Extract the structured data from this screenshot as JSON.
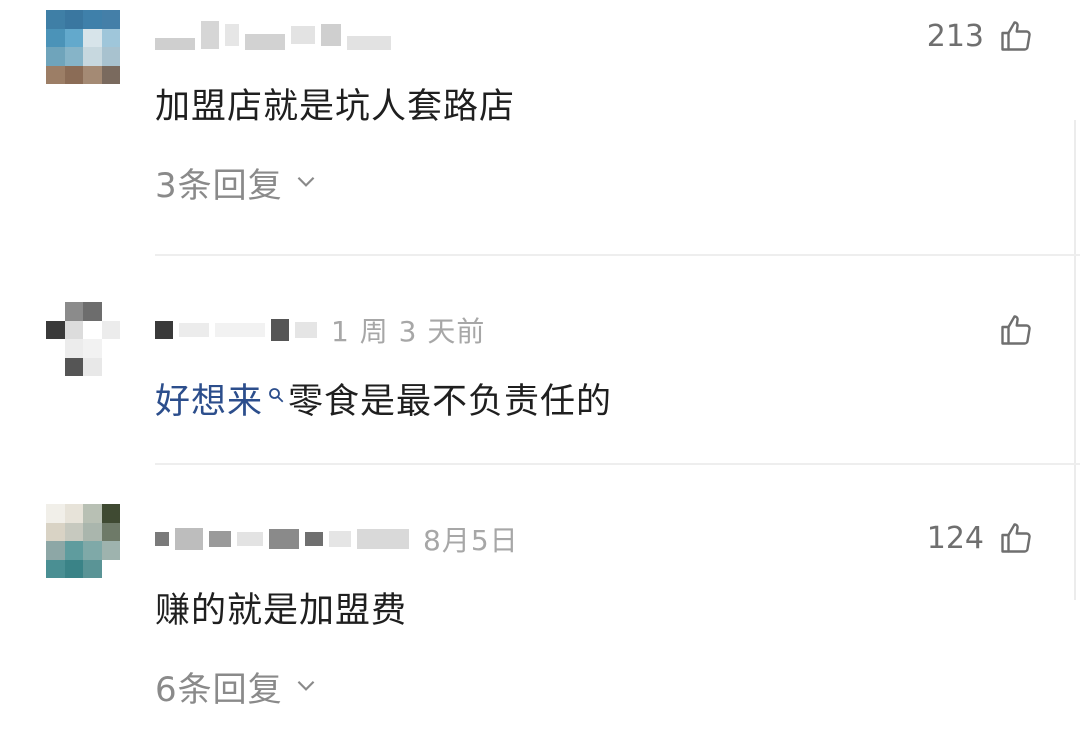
{
  "comments": [
    {
      "time": "",
      "likes": "213",
      "text": "加盟店就是坑人套路店",
      "replies": "3条回复"
    },
    {
      "time": "1 周 3 天前",
      "likes": "",
      "text_link": "好想来",
      "text": "零食是最不负责任的",
      "replies": ""
    },
    {
      "time": "8月5日",
      "likes": "124",
      "text": "赚的就是加盟费",
      "replies": "6条回复"
    }
  ],
  "icons": {
    "like": "thumbs-up-icon",
    "expand": "chevron-down-icon",
    "search": "search-icon"
  },
  "colors": {
    "text": "#1f1f1f",
    "muted": "#8a8a8a",
    "link": "#2c4e8c",
    "divider": "#eeeeee"
  }
}
